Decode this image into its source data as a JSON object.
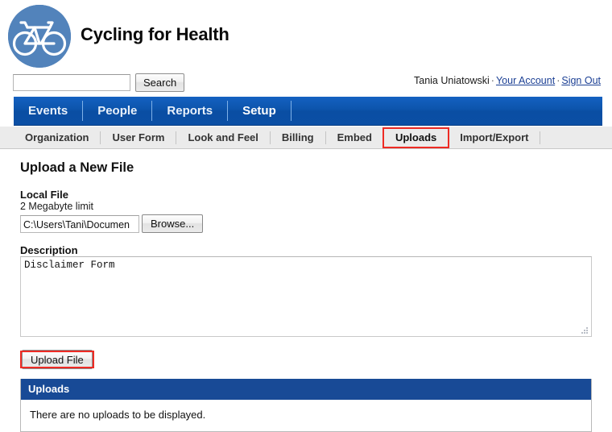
{
  "header": {
    "site_title": "Cycling for Health",
    "logo_icon": "bicycle-in-circle-logo",
    "logo_color": "#5283bb"
  },
  "search": {
    "value": "",
    "placeholder": "",
    "button_label": "Search",
    "icon": "search-icon"
  },
  "account": {
    "user_name": "Tania Uniatowski",
    "separator": "·",
    "your_account_label": "Your Account",
    "sign_out_label": "Sign Out"
  },
  "primary_nav": {
    "items": [
      {
        "label": "Events",
        "active": false
      },
      {
        "label": "People",
        "active": false
      },
      {
        "label": "Reports",
        "active": false
      },
      {
        "label": "Setup",
        "active": true
      }
    ],
    "background_color": "#0d55ad"
  },
  "secondary_nav": {
    "items": [
      {
        "label": "Organization",
        "active": false,
        "annotated": false
      },
      {
        "label": "User Form",
        "active": false,
        "annotated": false
      },
      {
        "label": "Look and Feel",
        "active": false,
        "annotated": false
      },
      {
        "label": "Billing",
        "active": false,
        "annotated": false
      },
      {
        "label": "Embed",
        "active": false,
        "annotated": false
      },
      {
        "label": "Uploads",
        "active": true,
        "annotated": true
      },
      {
        "label": "Import/Export",
        "active": false,
        "annotated": false
      }
    ],
    "annotation_color": "#ee2b24"
  },
  "main": {
    "page_title": "Upload a New File",
    "local_file": {
      "label": "Local File",
      "hint": "2 Megabyte limit",
      "path_value": "C:\\Users\\Tani\\Documen",
      "browse_label": "Browse..."
    },
    "description": {
      "label": "Description",
      "value": "Disclaimer Form",
      "placeholder": ""
    },
    "upload_button_label": "Upload File"
  },
  "uploads_table": {
    "header": "Uploads",
    "header_color": "#184a96",
    "empty_message": "There are no uploads to be displayed."
  }
}
